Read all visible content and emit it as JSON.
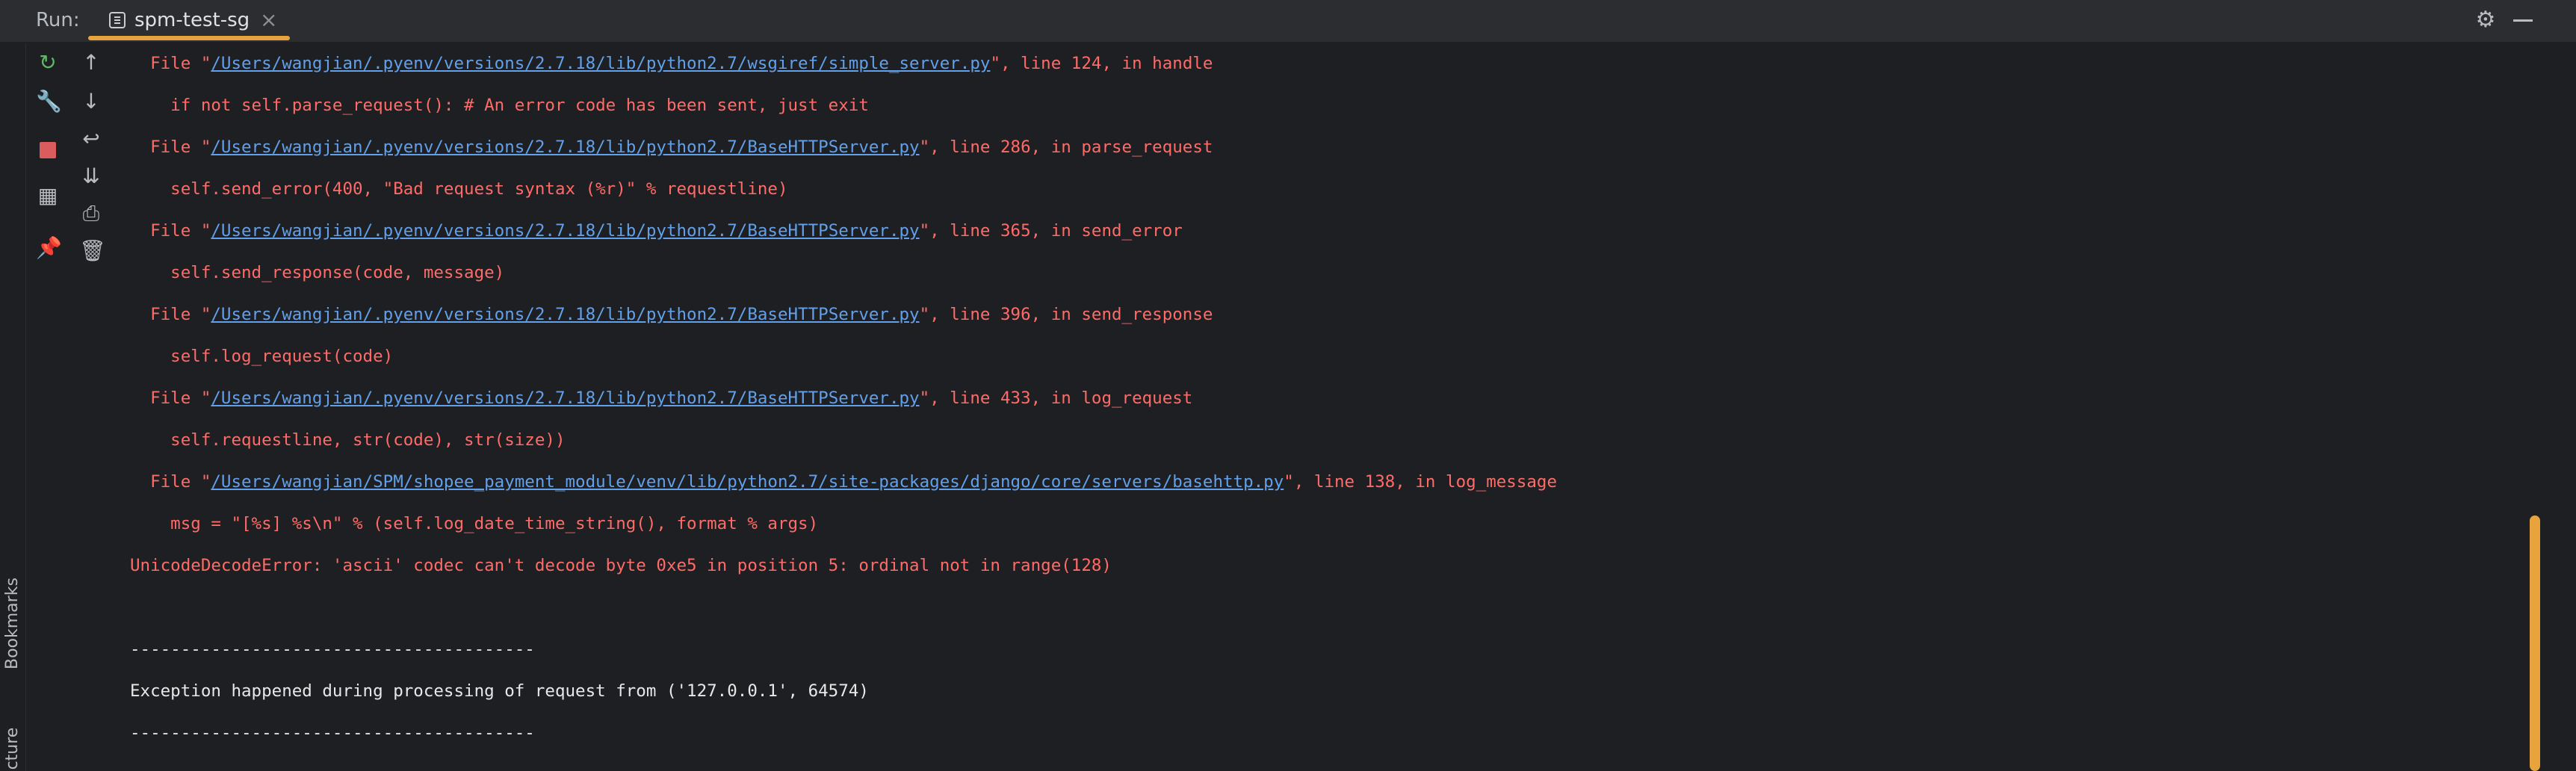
{
  "header": {
    "run_label": "Run:",
    "tab_label": "spm-test-sg",
    "tab_close": "×"
  },
  "side_labels": {
    "bookmarks": "Bookmarks",
    "structure": "Structure"
  },
  "console": {
    "lines": [
      {
        "pre": "  File \"",
        "link": "/Users/wangjian/.pyenv/versions/2.7.18/lib/python2.7/wsgiref/simple_server.py",
        "post": "\", line 124, in handle"
      },
      {
        "text": "    if not self.parse_request(): # An error code has been sent, just exit"
      },
      {
        "pre": "  File \"",
        "link": "/Users/wangjian/.pyenv/versions/2.7.18/lib/python2.7/BaseHTTPServer.py",
        "post": "\", line 286, in parse_request"
      },
      {
        "text": "    self.send_error(400, \"Bad request syntax (%r)\" % requestline)"
      },
      {
        "pre": "  File \"",
        "link": "/Users/wangjian/.pyenv/versions/2.7.18/lib/python2.7/BaseHTTPServer.py",
        "post": "\", line 365, in send_error"
      },
      {
        "text": "    self.send_response(code, message)"
      },
      {
        "pre": "  File \"",
        "link": "/Users/wangjian/.pyenv/versions/2.7.18/lib/python2.7/BaseHTTPServer.py",
        "post": "\", line 396, in send_response"
      },
      {
        "text": "    self.log_request(code)"
      },
      {
        "pre": "  File \"",
        "link": "/Users/wangjian/.pyenv/versions/2.7.18/lib/python2.7/BaseHTTPServer.py",
        "post": "\", line 433, in log_request"
      },
      {
        "text": "    self.requestline, str(code), str(size))"
      },
      {
        "pre": "  File \"",
        "link": "/Users/wangjian/SPM/shopee_payment_module/venv/lib/python2.7/site-packages/django/core/servers/basehttp.py",
        "post": "\", line 138, in log_message"
      },
      {
        "text": "    msg = \"[%s] %s\\n\" % (self.log_date_time_string(), format % args)"
      },
      {
        "text": "UnicodeDecodeError: 'ascii' codec can't decode byte 0xe5 in position 5: ordinal not in range(128)"
      },
      {
        "text": ""
      },
      {
        "text": "----------------------------------------",
        "color": "white"
      },
      {
        "text": "Exception happened during processing of request from ('127.0.0.1', 64574)",
        "color": "white"
      },
      {
        "text": "----------------------------------------",
        "color": "white"
      }
    ]
  },
  "colors": {
    "error": "#ff6b68",
    "link": "#62a0ea",
    "accent": "#e8a33d",
    "rerun": "#5fb865",
    "stop": "#db5c5c"
  },
  "icons": {
    "col1": [
      "rerun-icon",
      "wrench-icon",
      "stop-icon",
      "layout-icon",
      "pin-icon"
    ],
    "col2": [
      "arrow-up-icon",
      "arrow-down-icon",
      "soft-wrap-icon",
      "scroll-to-end-icon",
      "print-icon",
      "trash-icon"
    ]
  }
}
